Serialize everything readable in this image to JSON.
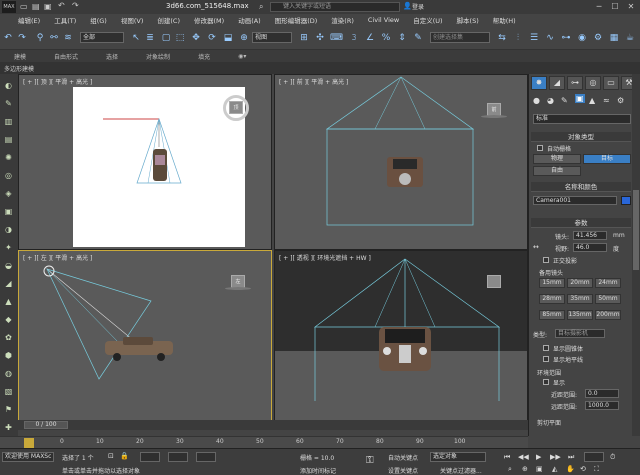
{
  "titlebar": {
    "logo_text": "MAX",
    "title": "3d66.com_515648.max",
    "search_placeholder": "键入关键字或短语",
    "login": "登录"
  },
  "menu": [
    "编辑(E)",
    "工具(T)",
    "组(G)",
    "视图(V)",
    "创建(C)",
    "修改器(M)",
    "动画(A)",
    "图形编辑器(D)",
    "渲染(R)",
    "Civil View",
    "自定义(U)",
    "脚本(S)",
    "帮助(H)"
  ],
  "toolbar": {
    "filter_value": "全部",
    "refcoord_value": "视图",
    "selection_set_placeholder": "创建选择集"
  },
  "ribbon_tabs": [
    "建模",
    "自由形式",
    "选择",
    "对象绘制",
    "填充"
  ],
  "subtab": "多边形建模",
  "viewports": {
    "top": "[ + ][ 顶 ][ 平滑 + 高光 ]",
    "front": "[ + ][ 前 ][ 平滑 + 高光 ]",
    "left": "[ + ][ 左 ][ 平滑 + 高光 ]",
    "perspective": "[ + ][ 透视 ][ 环境光遮挡 + HW ]",
    "top_cube_label": "顶",
    "front_cube_label": "前",
    "left_cube_label": "左"
  },
  "cmdpanel": {
    "category_value": "标准",
    "object_type_header": "对象类型",
    "auto_grid": "自动栅格",
    "btn_physical": "物理",
    "btn_target": "目标",
    "btn_free": "自由",
    "name_color_header": "名称和颜色",
    "object_name": "Camera001",
    "params_header": "参数",
    "lens_label": "镜头:",
    "lens_value": "41.456",
    "lens_unit": "mm",
    "fov_label": "视野:",
    "fov_value": "46.0",
    "fov_unit": "度",
    "ortho_label": "正交投影",
    "stock_lens_label": "备用镜头",
    "lenses": [
      "15mm",
      "20mm",
      "24mm",
      "28mm",
      "35mm",
      "50mm",
      "85mm",
      "135mm",
      "200mm"
    ],
    "type_label": "类型:",
    "type_value": "目标摄影机",
    "show_cone": "显示圆锥体",
    "show_horizon": "显示地平线",
    "env_range_label": "环境范围",
    "show_label": "显示",
    "near_range_label": "近距范围:",
    "near_range_value": "0.0",
    "far_range_label": "远距范围:",
    "far_range_value": "1000.0",
    "clip_header": "剪切平面"
  },
  "timeline": {
    "frame_display": "0 / 100",
    "ticks": [
      "0",
      "10",
      "20",
      "30",
      "40",
      "50",
      "60",
      "70",
      "80",
      "90",
      "100"
    ]
  },
  "status": {
    "selection": "选择了 1 个",
    "prompt": "单击或单击并拖动以选择对象",
    "grid": "栅格 = 10.0",
    "auto_key": "自动关键点",
    "set_key": "设置关键点",
    "key_mode_value": "选定对象",
    "key_filter": "关键点过滤器...",
    "welcome": "欢迎使用 MAXSc",
    "add_time_tag": "添加时间标记"
  }
}
